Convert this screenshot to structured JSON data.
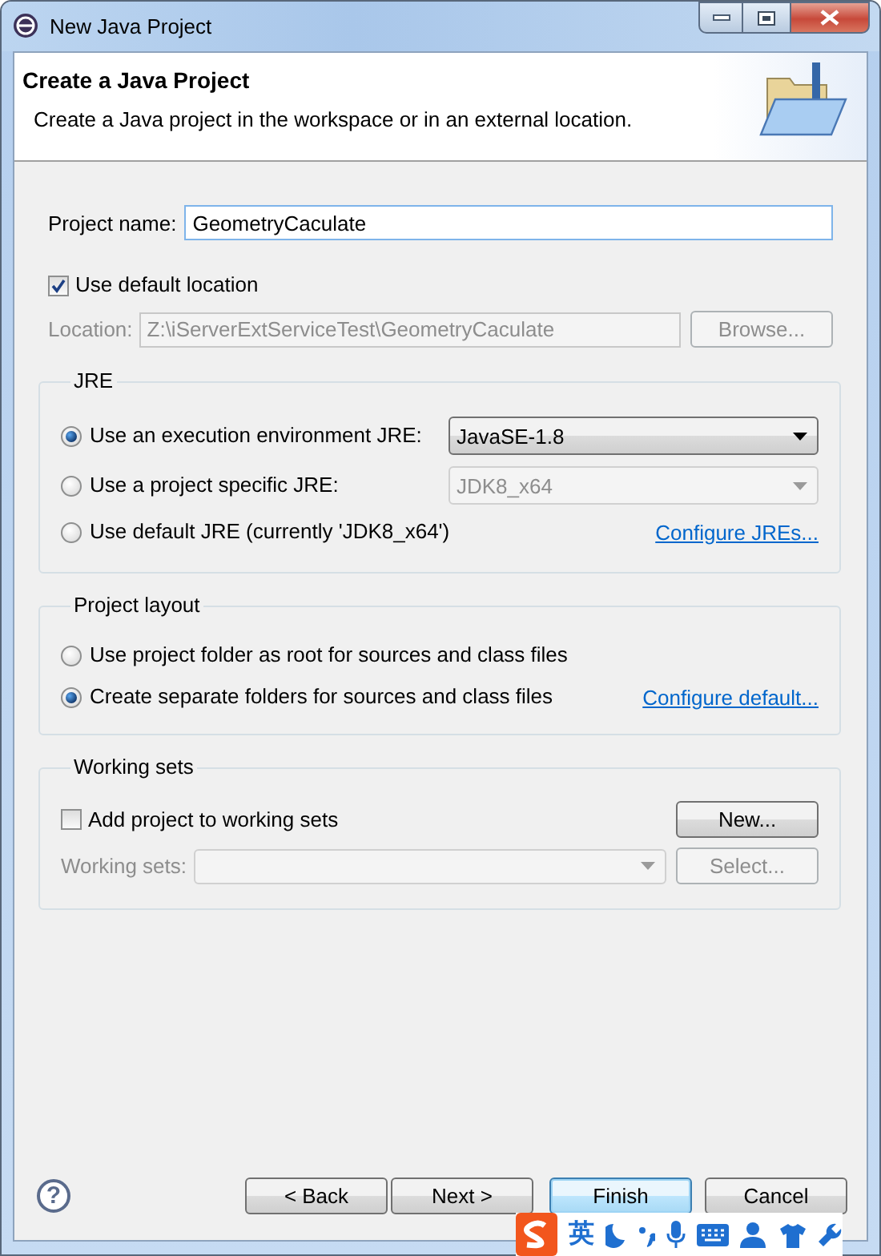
{
  "window": {
    "title": "New Java Project"
  },
  "banner": {
    "title": "Create a Java Project",
    "description": "Create a Java project in the workspace or in an external location."
  },
  "project_name": {
    "label": "Project name:",
    "value": "GeometryCaculate"
  },
  "default_location": {
    "label": "Use default location",
    "checked": true
  },
  "location": {
    "label": "Location:",
    "value": "Z:\\iServerExtServiceTest\\GeometryCaculate",
    "disabled": true,
    "button": "Browse..."
  },
  "jre": {
    "legend": "JRE",
    "options": [
      {
        "kind": "combo",
        "label": "Use an execution environment JRE:",
        "selected": true,
        "combo": {
          "value": "JavaSE-1.8",
          "disabled": false
        }
      },
      {
        "kind": "combo",
        "label": "Use a project specific JRE:",
        "selected": false,
        "combo": {
          "value": "JDK8_x64",
          "disabled": true
        }
      },
      {
        "kind": "link",
        "label": "Use default JRE (currently 'JDK8_x64')",
        "selected": false,
        "link": "Configure JREs..."
      }
    ]
  },
  "project_layout": {
    "legend": "Project layout",
    "options": [
      {
        "kind": "plain",
        "label": "Use project folder as root for sources and class files",
        "selected": false
      },
      {
        "kind": "link",
        "label": "Create separate folders for sources and class files",
        "selected": true,
        "link": "Configure default..."
      }
    ]
  },
  "working_sets": {
    "legend": "Working sets",
    "add": {
      "label": "Add project to working sets",
      "checked": false
    },
    "new_button": "New...",
    "sets": {
      "label": "Working sets:",
      "disabled": true
    },
    "select_button": {
      "label": "Select...",
      "disabled": true
    }
  },
  "footer": {
    "help": "?",
    "buttons": [
      {
        "label": "< Back",
        "focused": false
      },
      {
        "label": "Next >",
        "focused": false
      },
      {
        "label": "Finish",
        "focused": true
      },
      {
        "label": "Cancel",
        "focused": false
      }
    ]
  },
  "ime_toolbar": {
    "mode": "英"
  }
}
